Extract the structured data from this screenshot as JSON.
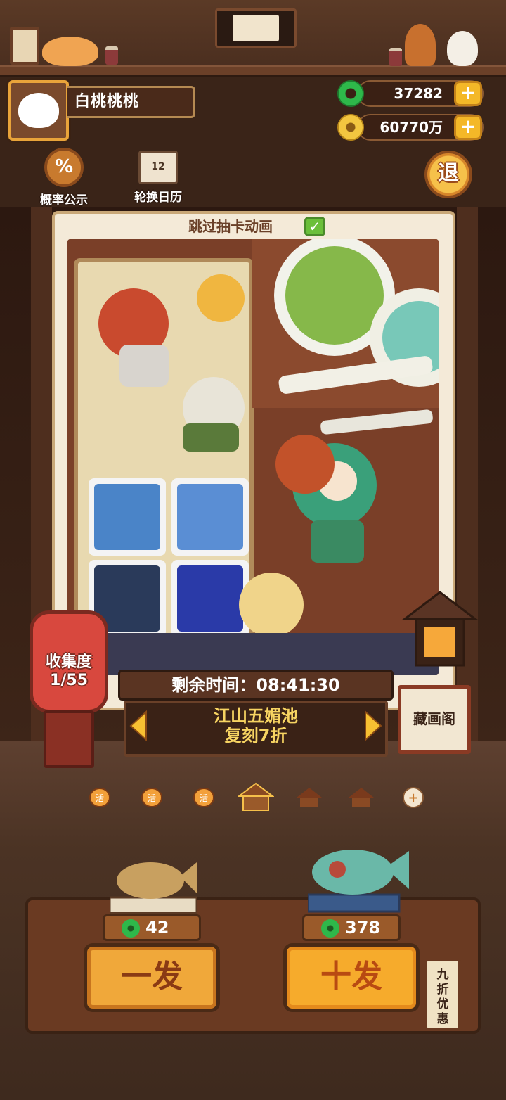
{
  "player": {
    "name": "白桃桃桃"
  },
  "currency": {
    "jade": "37282",
    "gold": "60770万"
  },
  "top_tools": {
    "rates_icon_text": "%",
    "rates_label": "概率公示",
    "calendar_icon_text": "12",
    "calendar_label": "轮换日历",
    "exit_label": "退"
  },
  "card_panel": {
    "skip_animation_label": "跳过抽卡动画",
    "skip_animation_checked": true
  },
  "collection": {
    "label": "收集度",
    "progress": "1/55"
  },
  "banner": {
    "timer_label": "剩余时间：",
    "timer_value": "08:41:30",
    "pool_name_line1": "江山五媚池",
    "pool_name_line2": "复刻7折"
  },
  "gallery_button_label": "藏画阁",
  "page_dots": [
    {
      "icon": "lantern-icon",
      "text": "活",
      "active": false
    },
    {
      "icon": "lantern-icon",
      "text": "活",
      "active": false
    },
    {
      "icon": "lantern-icon",
      "text": "活",
      "active": false
    },
    {
      "icon": "house-icon",
      "text": "",
      "active": true
    },
    {
      "icon": "house-icon",
      "text": "",
      "active": false
    },
    {
      "icon": "house-icon",
      "text": "",
      "active": false
    },
    {
      "icon": "plus-icon",
      "text": "+",
      "active": false
    }
  ],
  "draw": {
    "single_cost": "42",
    "single_label": "一发",
    "ten_cost": "378",
    "ten_label": "十发",
    "discount_label": "九折优惠"
  },
  "colors": {
    "jade_green": "#2eb84a",
    "gold": "#f3c640",
    "button_orange": "#f0a83a",
    "lantern_red": "#d8483e"
  }
}
